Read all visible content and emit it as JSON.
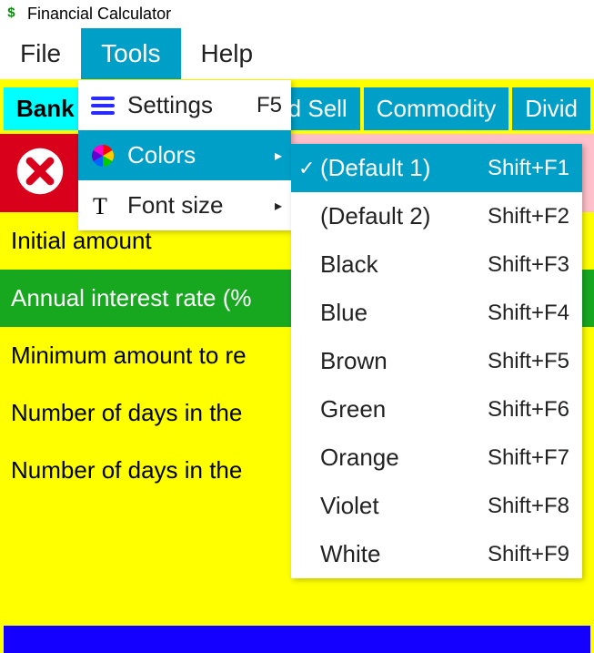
{
  "window": {
    "title": "Financial Calculator"
  },
  "menubar": {
    "items": [
      {
        "label": "File"
      },
      {
        "label": "Tools"
      },
      {
        "label": "Help"
      }
    ],
    "active_index": 1
  },
  "tabs": {
    "items": [
      {
        "label": "Bank"
      },
      {
        "label": "d Sell"
      },
      {
        "label": "Commodity"
      },
      {
        "label": "Divid"
      }
    ],
    "active_index": 0
  },
  "form": {
    "rows": [
      {
        "label": "Initial amount",
        "style": "plain"
      },
      {
        "label": "Annual interest rate (%",
        "style": "green"
      },
      {
        "label": "Minimum amount to re",
        "style": "plain"
      },
      {
        "label": "Number of days in the",
        "style": "plain"
      },
      {
        "label": "Number of days in the",
        "style": "plain"
      }
    ]
  },
  "tools_menu": {
    "items": [
      {
        "icon": "hamburger",
        "label": "Settings",
        "shortcut": "F5",
        "submenu": false
      },
      {
        "icon": "colorwheel",
        "label": "Colors",
        "shortcut": "",
        "submenu": true
      },
      {
        "icon": "font",
        "label": "Font size",
        "shortcut": "",
        "submenu": true
      }
    ],
    "highlight_index": 1
  },
  "colors_submenu": {
    "items": [
      {
        "label": "(Default 1)",
        "shortcut": "Shift+F1",
        "checked": true
      },
      {
        "label": "(Default 2)",
        "shortcut": "Shift+F2",
        "checked": false
      },
      {
        "label": "Black",
        "shortcut": "Shift+F3",
        "checked": false
      },
      {
        "label": "Blue",
        "shortcut": "Shift+F4",
        "checked": false
      },
      {
        "label": "Brown",
        "shortcut": "Shift+F5",
        "checked": false
      },
      {
        "label": "Green",
        "shortcut": "Shift+F6",
        "checked": false
      },
      {
        "label": "Orange",
        "shortcut": "Shift+F7",
        "checked": false
      },
      {
        "label": "Violet",
        "shortcut": "Shift+F8",
        "checked": false
      },
      {
        "label": "White",
        "shortcut": "Shift+F9",
        "checked": false
      }
    ],
    "highlight_index": 0
  }
}
